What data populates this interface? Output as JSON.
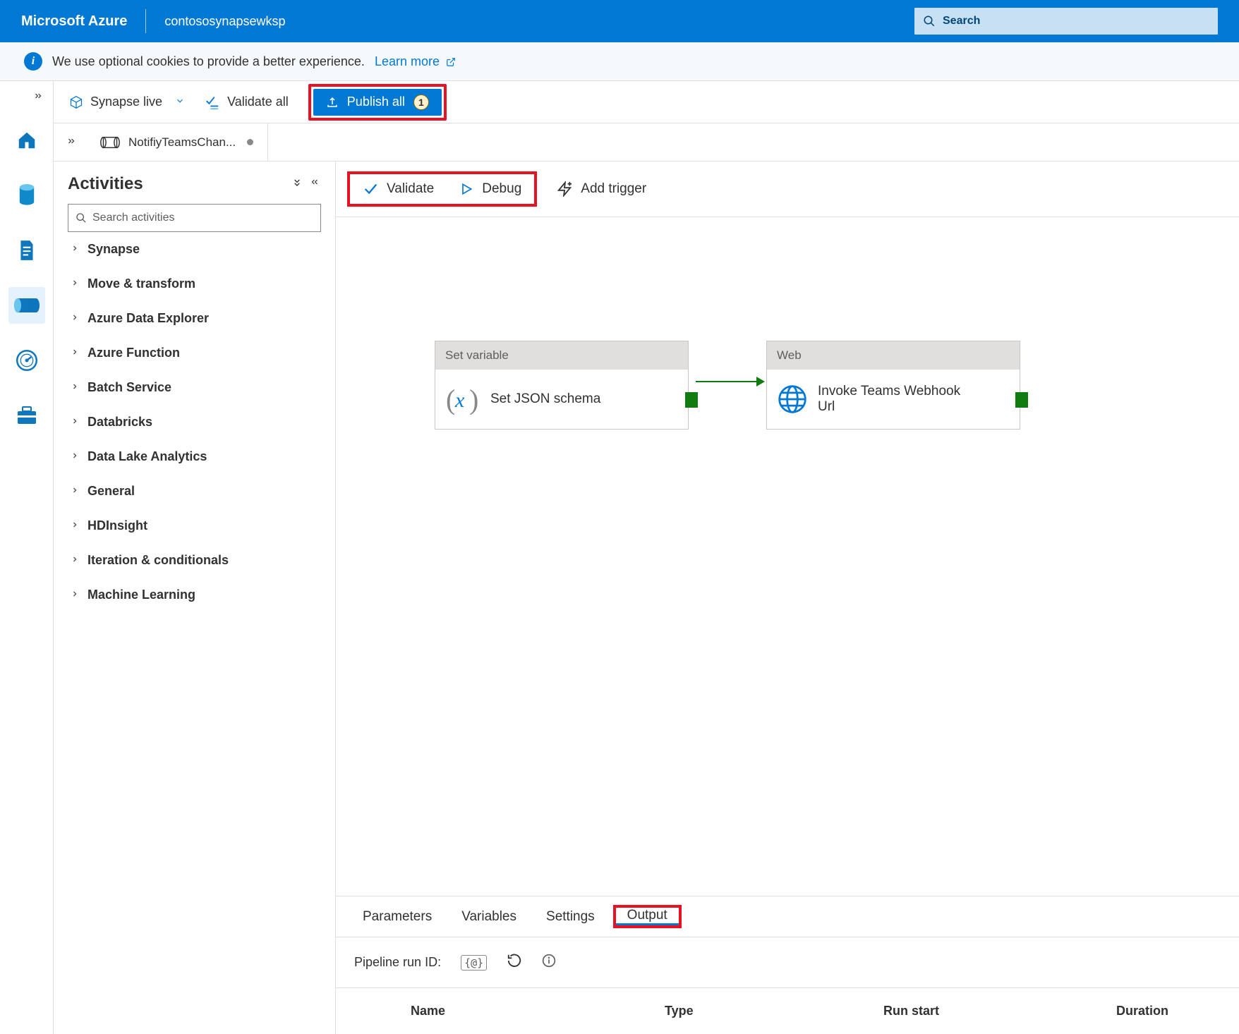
{
  "header": {
    "brand": "Microsoft Azure",
    "workspace": "contososynapsewksp",
    "search_placeholder": "Search"
  },
  "banner": {
    "message": "We use optional cookies to provide a better experience.",
    "link_label": "Learn more"
  },
  "toolbar": {
    "live_mode": "Synapse live",
    "validate_all": "Validate all",
    "publish_all": "Publish all",
    "publish_count": "1"
  },
  "tab": {
    "name": "NotifiyTeamsChan..."
  },
  "activities": {
    "title": "Activities",
    "search_placeholder": "Search activities",
    "groups": [
      "Synapse",
      "Move & transform",
      "Azure Data Explorer",
      "Azure Function",
      "Batch Service",
      "Databricks",
      "Data Lake Analytics",
      "General",
      "HDInsight",
      "Iteration & conditionals",
      "Machine Learning"
    ]
  },
  "canvas_toolbar": {
    "validate": "Validate",
    "debug": "Debug",
    "add_trigger": "Add trigger"
  },
  "nodes": {
    "set_variable": {
      "header": "Set variable",
      "label": "Set JSON schema"
    },
    "web_activity": {
      "header": "Web",
      "label": "Invoke Teams Webhook Url"
    }
  },
  "bottom_tabs": {
    "parameters": "Parameters",
    "variables": "Variables",
    "settings": "Settings",
    "output": "Output"
  },
  "run": {
    "label": "Pipeline run ID:"
  },
  "table": {
    "name": "Name",
    "type": "Type",
    "run_start": "Run start",
    "duration": "Duration"
  }
}
